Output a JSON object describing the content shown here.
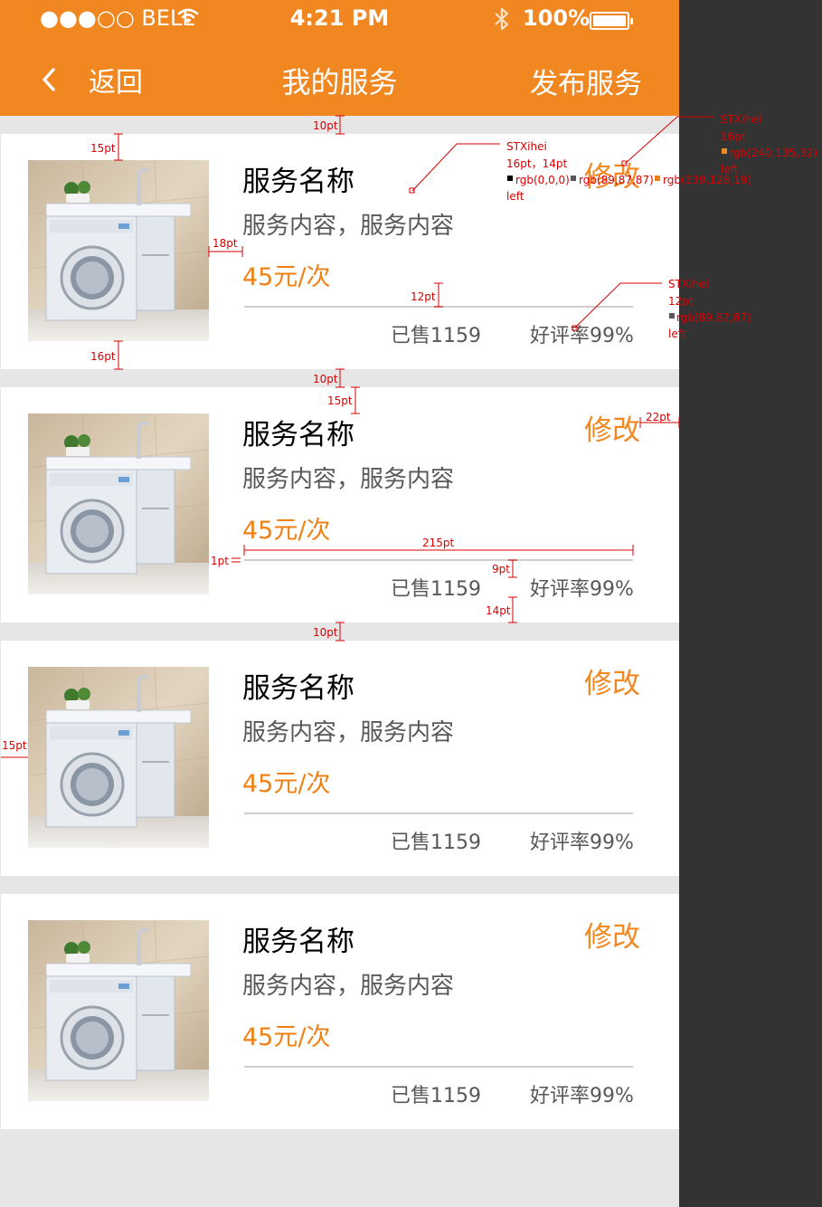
{
  "status_bar": {
    "carrier": "●●●○○ BELL",
    "time": "4:21 PM",
    "battery": "100%",
    "battery_level": 1.0
  },
  "nav": {
    "back_label": "返回",
    "title": "我的服务",
    "action_label": "发布服务"
  },
  "services": [
    {
      "name": "服务名称",
      "description": "服务内容，服务内容",
      "price": "45元/次",
      "edit_label": "修改",
      "sold": "已售1159",
      "rating": "好评率99%"
    },
    {
      "name": "服务名称",
      "description": "服务内容，服务内容",
      "price": "45元/次",
      "edit_label": "修改",
      "sold": "已售1159",
      "rating": "好评率99%"
    },
    {
      "name": "服务名称",
      "description": "服务内容，服务内容",
      "price": "45元/次",
      "edit_label": "修改",
      "sold": "已售1159",
      "rating": "好评率99%"
    },
    {
      "name": "服务名称",
      "description": "服务内容，服务内容",
      "price": "45元/次",
      "edit_label": "修改",
      "sold": "已售1159",
      "rating": "好评率99%"
    }
  ],
  "colors": {
    "header_bg": "#f08720",
    "accent": "#ef8013",
    "text_dark": "#000000",
    "text_gray": "#595757",
    "page_bg": "#e6e6e6",
    "side_bg": "#333333"
  },
  "annotations": {
    "gap_10pt": "10pt",
    "pad_15pt": "15pt",
    "pad_16pt": "16pt",
    "gap_18pt": "18pt",
    "gap_12pt": "12pt",
    "gap_22pt": "22pt",
    "gap_9pt": "9pt",
    "gap_14pt": "14pt",
    "line_1pt": "1pt",
    "width_215pt": "215pt",
    "font_name": "STXihei",
    "title_spec": "16pt，14pt",
    "color_black": "rgb(0,0,0)",
    "color_gray": "rgb(89,87,87)",
    "color_price": "rgb(239,128,19)",
    "align_left": "left",
    "edit_size": "16pt",
    "color_edit": "rgb(240,135,32)",
    "stat_size": "12pt"
  }
}
